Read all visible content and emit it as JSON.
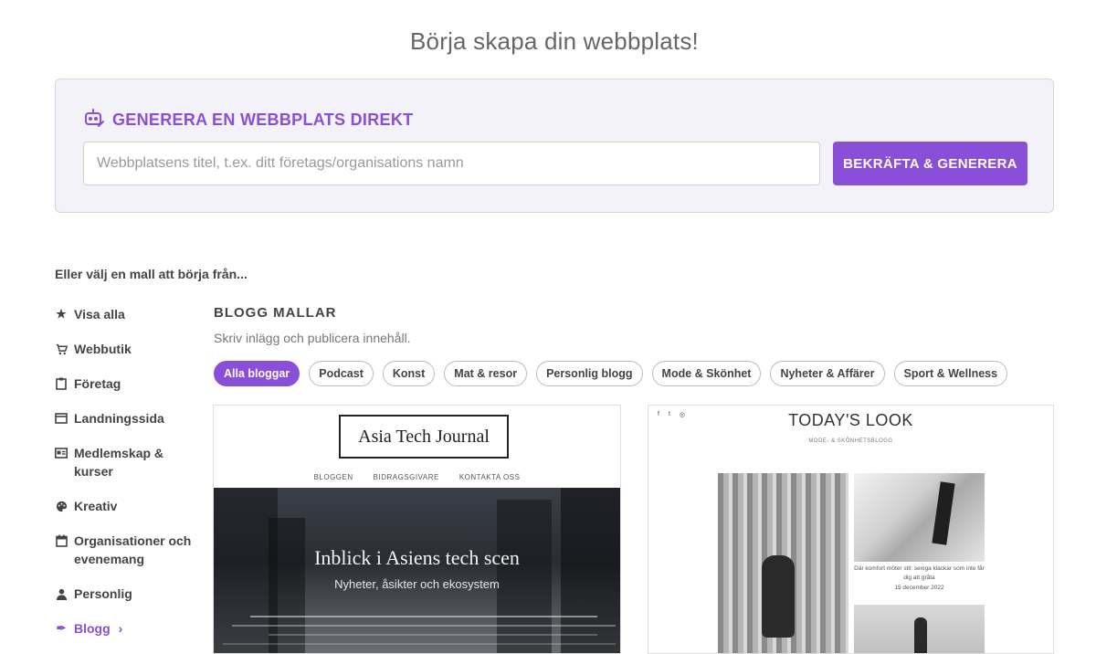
{
  "page_title": "Börja skapa din webbplats!",
  "generator": {
    "icon": "robot-icon",
    "heading": "GENERERA EN WEBBPLATS DIREKT",
    "input_placeholder": "Webbplatsens titel, t.ex. ditt företags/organisations namn",
    "input_value": "",
    "button_label": "BEKRÄFTA & GENERERA",
    "accent_color": "#8a4fd8"
  },
  "choose_label": "Eller välj en mall att börja från...",
  "sidebar": {
    "items": [
      {
        "label": "Visa alla",
        "icon": "star-icon",
        "glyph": "★"
      },
      {
        "label": "Webbutik",
        "icon": "cart-icon",
        "glyph": "🛒"
      },
      {
        "label": "Företag",
        "icon": "clipboard-icon",
        "glyph": "📋"
      },
      {
        "label": "Landningssida",
        "icon": "window-icon",
        "glyph": "▭"
      },
      {
        "label": "Medlemskap & kurser",
        "icon": "id-card-icon",
        "glyph": "🪪"
      },
      {
        "label": "Kreativ",
        "icon": "palette-icon",
        "glyph": "🎨"
      },
      {
        "label": "Organisationer och evenemang",
        "icon": "calendar-icon",
        "glyph": "📅"
      },
      {
        "label": "Personlig",
        "icon": "user-icon",
        "glyph": "👤"
      },
      {
        "label": "Blogg",
        "icon": "feather-icon",
        "glyph": "✒",
        "active": true,
        "chevron": "›"
      }
    ]
  },
  "section": {
    "title": "BLOGG MALLAR",
    "subtitle": "Skriv inlägg och publicera innehåll."
  },
  "chips": [
    {
      "label": "Alla bloggar",
      "active": true
    },
    {
      "label": "Podcast"
    },
    {
      "label": "Konst"
    },
    {
      "label": "Mat & resor"
    },
    {
      "label": "Personlig blogg"
    },
    {
      "label": "Mode & Skönhet"
    },
    {
      "label": "Nyheter & Affärer"
    },
    {
      "label": "Sport & Wellness"
    }
  ],
  "templates": [
    {
      "logo": "Asia Tech Journal",
      "nav": [
        "BLOGGEN",
        "BIDRAGSGIVARE",
        "KONTAKTA OSS"
      ],
      "hero_title": "Inblick i Asiens tech scen",
      "hero_subtitle": "Nyheter, åsikter och ekosystem"
    },
    {
      "social": [
        "f",
        "t",
        "◎"
      ],
      "title": "TODAY'S LOOK",
      "subtitle": "MODE- & SKÖNHETSBLOGG",
      "caption": "Där komfort möter stil: sexiga klackar som inte får dig att gråta",
      "date": "15 december 2022"
    }
  ]
}
